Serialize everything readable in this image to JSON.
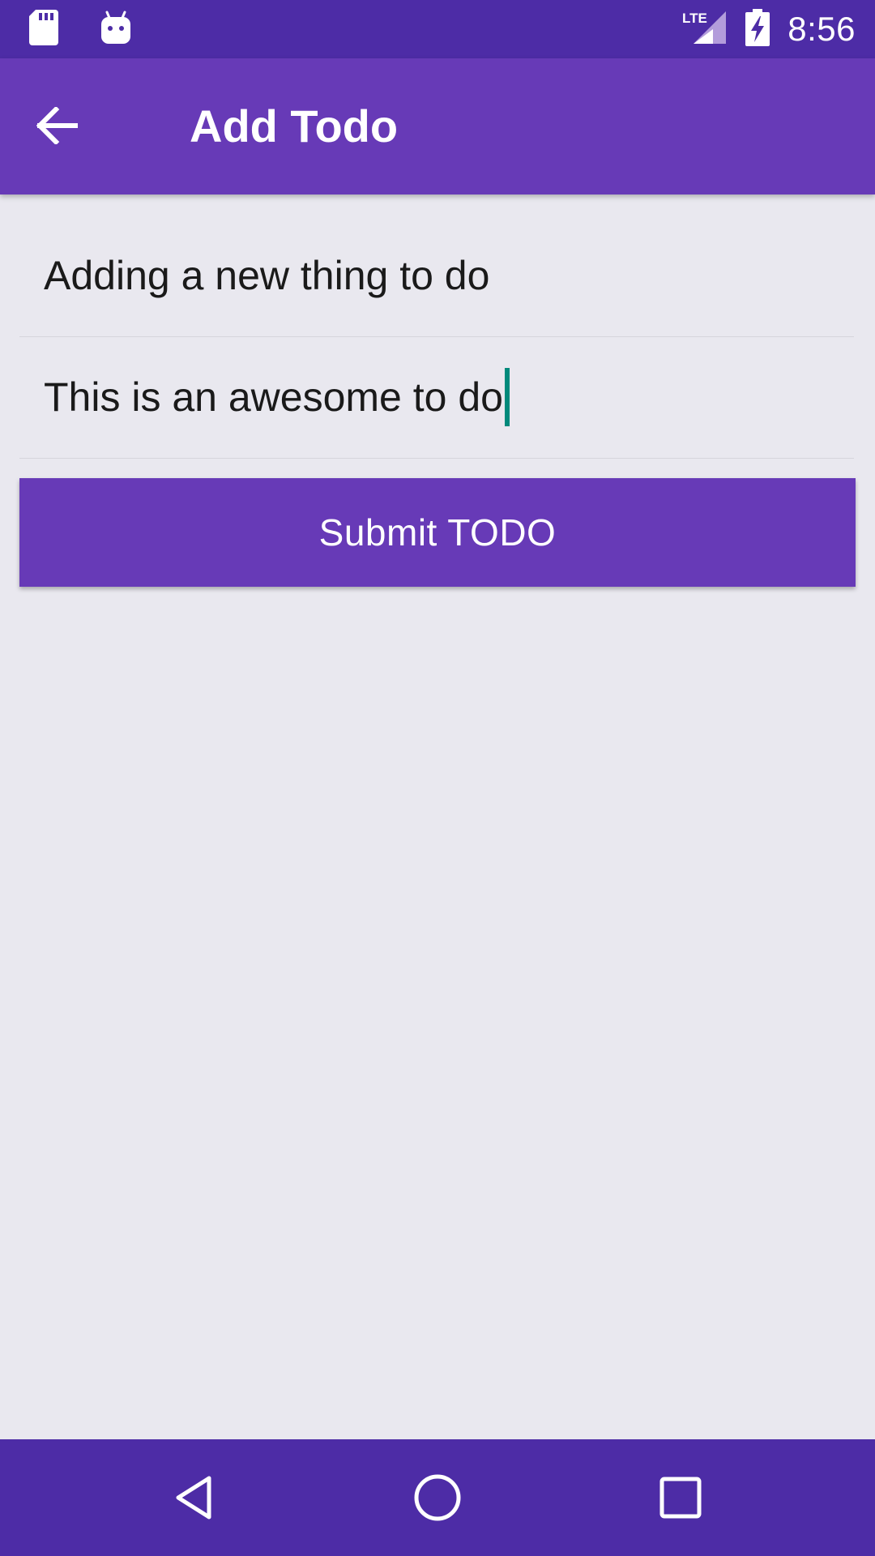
{
  "status_bar": {
    "time": "8:56",
    "network": "LTE",
    "icons": [
      "sd-card-icon",
      "android-icon",
      "lte-signal-icon",
      "battery-charging-icon"
    ]
  },
  "app_bar": {
    "title": "Add Todo",
    "back_icon": "arrow-back-icon"
  },
  "form": {
    "title_field": {
      "value": "Adding a new thing to do"
    },
    "description_field": {
      "value": "This is an awesome to do"
    },
    "submit_label": "Submit TODO"
  },
  "nav_bar": {
    "icons": [
      "nav-back-icon",
      "nav-home-icon",
      "nav-recents-icon"
    ]
  },
  "colors": {
    "status_bar": "#4d2ca6",
    "primary": "#673ab7",
    "background": "#e9e8ef",
    "caret": "#00897b"
  }
}
